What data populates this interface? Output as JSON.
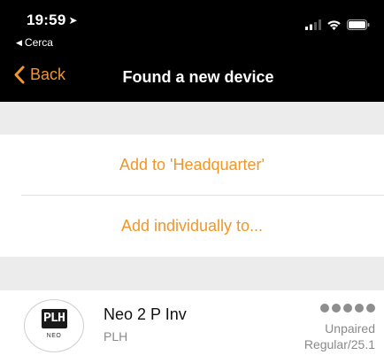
{
  "status_bar": {
    "time": "19:59",
    "back_app_label": "Cerca"
  },
  "nav": {
    "back_label": "Back",
    "title": "Found a new device"
  },
  "actions": [
    {
      "label": "Add to 'Headquarter'"
    },
    {
      "label": "Add individually to..."
    }
  ],
  "device": {
    "logo_mark": "PLH",
    "logo_sub": "NEO",
    "name": "Neo 2 P Inv",
    "brand": "PLH",
    "pair_status": "Unpaired",
    "firmware": "Regular/25.1",
    "signal_strength": 5,
    "signal_max": 5
  },
  "colors": {
    "accent": "#f0962a",
    "header_bg": "#000000",
    "section_bg": "#ececec"
  },
  "icons": [
    "location-arrow-icon",
    "cellular-signal-icon",
    "wifi-icon",
    "battery-icon",
    "chevron-left-icon"
  ]
}
